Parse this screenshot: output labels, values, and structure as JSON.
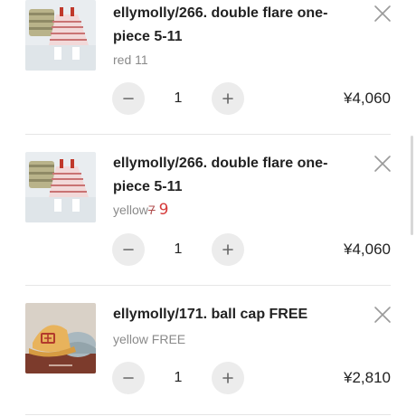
{
  "cart": {
    "items": [
      {
        "title": "ellymolly/266. double flare one-piece 5-11",
        "variant": "red 11",
        "quantity": "1",
        "price": "¥4,060"
      },
      {
        "title": "ellymolly/266. double flare one-piece 5-11",
        "variant": "yellow",
        "variant_struck": "7",
        "variant_fix": "9",
        "quantity": "1",
        "price": "¥4,060"
      },
      {
        "title": "ellymolly/171. ball cap FREE",
        "variant": "yellow FREE",
        "quantity": "1",
        "price": "¥2,810"
      }
    ]
  },
  "colors": {
    "stepper_bg": "#ececec",
    "variant_text": "#8a8a8a",
    "handwritten_fix": "#d63a3a"
  },
  "icons": [
    "close-icon",
    "minus-icon",
    "plus-icon"
  ]
}
